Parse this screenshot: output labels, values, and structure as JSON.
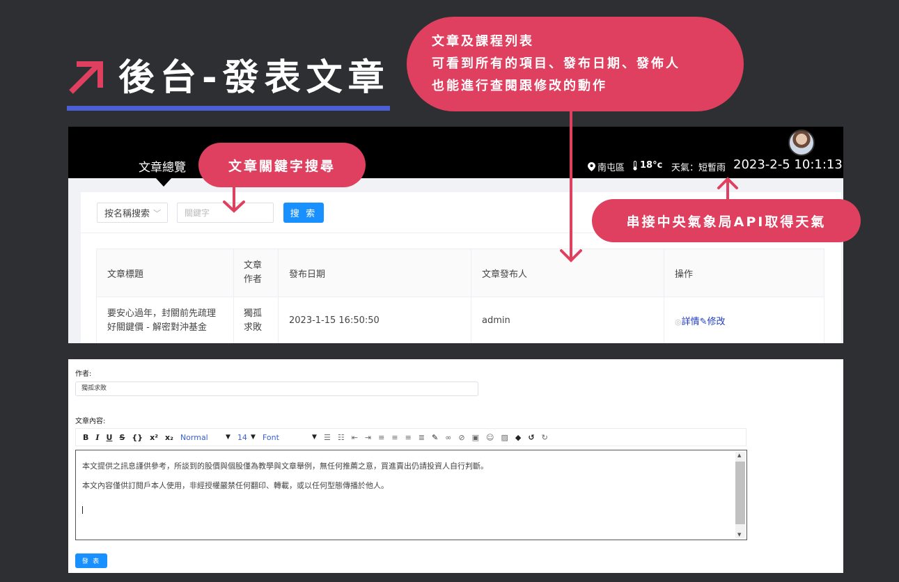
{
  "page_title": "後台-發表文章",
  "callouts": {
    "main_lines": [
      "文章及課程列表",
      "可看到所有的項目、發布日期、發佈人",
      "也能進行查閱跟修改的動作"
    ],
    "search": "文章關鍵字搜尋",
    "api": "串接中央氣象局API取得天氣"
  },
  "colors": {
    "background": "#2d2f33",
    "accent_red": "#e0405f",
    "underline_blue": "#4d5fd6",
    "primary_button": "#1890ff"
  },
  "topbar": {
    "nav_item": "文章總覽",
    "location": "南屯區",
    "temperature": "18°c",
    "weather": "天氣：短暫雨",
    "clock": "2023-2-5 10:1:13"
  },
  "filter": {
    "select_value": "按名稱搜索",
    "keyword_placeholder": "關鍵字",
    "search_label": "搜 索"
  },
  "table": {
    "headers": [
      "文章標題",
      "文章作者",
      "發布日期",
      "文章發布人",
      "操作"
    ],
    "rows": [
      {
        "title": "要安心過年，封關前先疏理好關鍵價 - 解密對沖基金",
        "author": "獨孤求敗",
        "date": "2023-1-15 16:50:50",
        "publisher": "admin",
        "detail": "詳情",
        "edit": "修改"
      }
    ]
  },
  "form": {
    "author_label": "作者:",
    "author_value": "獨孤求敗",
    "content_label": "文章內容:",
    "toolbar": {
      "bold": "B",
      "italic": "I",
      "underline": "U",
      "strike": "S",
      "code": "{}",
      "superscript": "x²",
      "subscript": "x₂",
      "heading": "Normal",
      "size": "14",
      "font": "Font"
    },
    "content_lines": [
      "本文提供之訊息謹供參考，所談到的股價與個股僅為教學與文章舉例，無任何推薦之意，買進賣出仍請投資人自行判斷。",
      "本文內容僅供訂閱戶本人使用，非經授權嚴禁任何翻印、轉載，或以任何型態傳播於他人。"
    ],
    "publish_label": "發 表"
  }
}
